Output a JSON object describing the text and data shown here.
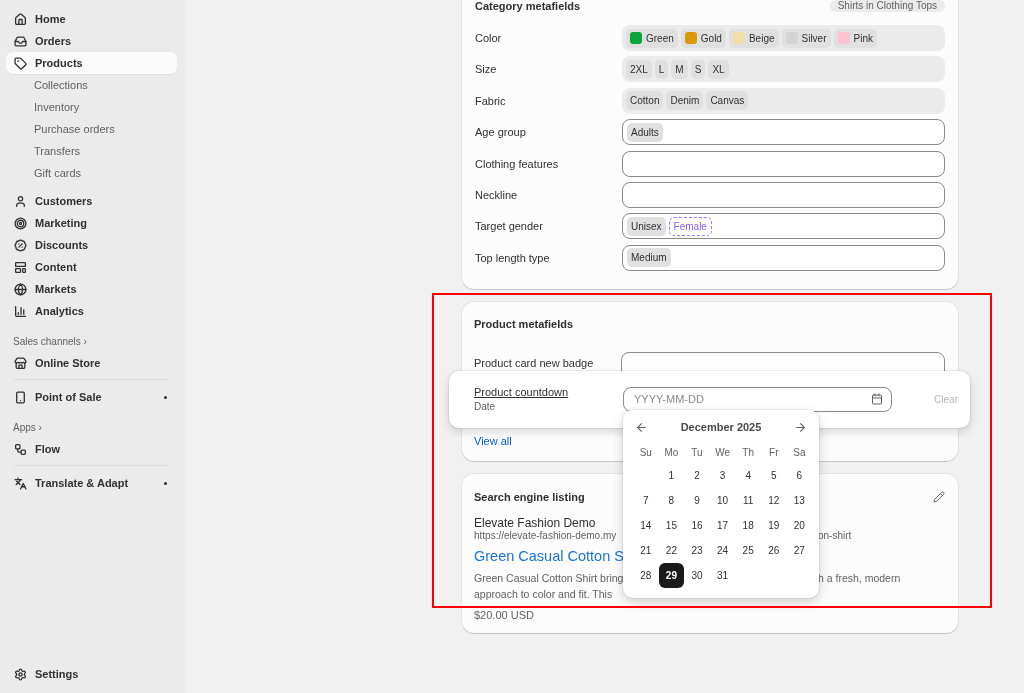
{
  "sidebar": {
    "items": [
      {
        "kind": "main",
        "label": "Home",
        "selected": false
      },
      {
        "kind": "main",
        "label": "Orders",
        "selected": false
      },
      {
        "kind": "main",
        "label": "Products",
        "selected": true
      },
      {
        "kind": "sub",
        "label": "Collections",
        "selected": false
      },
      {
        "kind": "sub",
        "label": "Inventory",
        "selected": false
      },
      {
        "kind": "sub",
        "label": "Purchase orders",
        "selected": false
      },
      {
        "kind": "sub",
        "label": "Transfers",
        "selected": false
      },
      {
        "kind": "sub",
        "label": "Gift cards",
        "selected": false
      },
      {
        "kind": "main",
        "label": "Customers",
        "selected": false,
        "gap_before": true
      },
      {
        "kind": "main",
        "label": "Marketing",
        "selected": false
      },
      {
        "kind": "main",
        "label": "Discounts",
        "selected": false
      },
      {
        "kind": "main",
        "label": "Content",
        "selected": false
      },
      {
        "kind": "main",
        "label": "Markets",
        "selected": false
      },
      {
        "kind": "main",
        "label": "Analytics",
        "selected": false
      },
      {
        "kind": "section",
        "label": "Sales channels",
        "chevron": "›"
      },
      {
        "kind": "main",
        "label": "Online Store",
        "selected": false
      },
      {
        "kind": "main",
        "label": "Point of Sale",
        "selected": false,
        "divider_before": true,
        "dot": true
      },
      {
        "kind": "section",
        "label": "Apps",
        "chevron": "›"
      },
      {
        "kind": "main",
        "label": "Flow",
        "selected": false
      },
      {
        "kind": "main",
        "label": "Translate & Adapt",
        "selected": false,
        "divider_before": true,
        "dot": true
      }
    ],
    "settings": "Settings"
  },
  "category_card": {
    "title": "Category metafields",
    "badge": "Shirts in Clothing Tops",
    "fields": [
      {
        "label": "Color",
        "kind": "swatches",
        "values": [
          {
            "label": "Green",
            "color": "#0ca53c"
          },
          {
            "label": "Gold",
            "color": "#d9990b"
          },
          {
            "label": "Beige",
            "color": "#f0dfa8"
          },
          {
            "label": "Silver",
            "color": "#d4d4d4"
          },
          {
            "label": "Pink",
            "color": "#fbc3cf"
          }
        ]
      },
      {
        "label": "Size",
        "kind": "readonly",
        "values": [
          {
            "label": "2XL"
          },
          {
            "label": "L"
          },
          {
            "label": "M"
          },
          {
            "label": "S"
          },
          {
            "label": "XL"
          }
        ]
      },
      {
        "label": "Fabric",
        "kind": "readonly",
        "values": [
          {
            "label": "Cotton"
          },
          {
            "label": "Denim"
          },
          {
            "label": "Canvas"
          }
        ]
      },
      {
        "label": "Age group",
        "kind": "input",
        "values": [
          {
            "label": "Adults",
            "suggested": false
          }
        ]
      },
      {
        "label": "Clothing features",
        "kind": "input"
      },
      {
        "label": "Neckline",
        "kind": "input"
      },
      {
        "label": "Target gender",
        "kind": "input",
        "values": [
          {
            "label": "Unisex",
            "suggested": false
          },
          {
            "label": "Female",
            "suggested": true
          }
        ]
      },
      {
        "label": "Top length type",
        "kind": "input",
        "values": [
          {
            "label": "Medium",
            "suggested": false
          }
        ]
      }
    ]
  },
  "product_card": {
    "title": "Product metafields",
    "fields": [
      {
        "label": "Product card new badge"
      }
    ],
    "active_field": {
      "label": "Product countdown",
      "type": "Date",
      "placeholder": "YYYY-MM-DD",
      "clear": "Clear"
    },
    "link": "View all"
  },
  "calendar": {
    "month": "December 2025",
    "weekdays": [
      "Su",
      "Mo",
      "Tu",
      "We",
      "Th",
      "Fr",
      "Sa"
    ],
    "weeks": [
      {
        "days": [
          {
            "label": "1",
            "selected": false
          },
          {
            "label": "2",
            "selected": false
          },
          {
            "label": "3",
            "selected": false
          },
          {
            "label": "4",
            "selected": false
          },
          {
            "label": "5",
            "selected": false
          },
          {
            "label": "6",
            "selected": false
          }
        ]
      },
      {
        "days": [
          {
            "label": "7",
            "selected": false
          },
          {
            "label": "8",
            "selected": false
          },
          {
            "label": "9",
            "selected": false
          },
          {
            "label": "10",
            "selected": false
          },
          {
            "label": "11",
            "selected": false
          },
          {
            "label": "12",
            "selected": false
          },
          {
            "label": "13",
            "selected": false
          }
        ]
      },
      {
        "days": [
          {
            "label": "14",
            "selected": false
          },
          {
            "label": "15",
            "selected": false
          },
          {
            "label": "16",
            "selected": false
          },
          {
            "label": "17",
            "selected": false
          },
          {
            "label": "18",
            "selected": false
          },
          {
            "label": "19",
            "selected": false
          },
          {
            "label": "20",
            "selected": false
          }
        ]
      },
      {
        "days": [
          {
            "label": "21",
            "selected": false
          },
          {
            "label": "22",
            "selected": false
          },
          {
            "label": "23",
            "selected": false
          },
          {
            "label": "24",
            "selected": false
          },
          {
            "label": "25",
            "selected": false
          },
          {
            "label": "26",
            "selected": false
          },
          {
            "label": "27",
            "selected": false
          }
        ]
      },
      {
        "days": [
          {
            "label": "28",
            "selected": false
          },
          {
            "label": "29",
            "selected": true
          },
          {
            "label": "30",
            "selected": false
          },
          {
            "label": "31",
            "selected": false
          }
        ]
      }
    ]
  },
  "seo_card": {
    "title": "Search engine listing",
    "store": "Elevate Fashion Demo",
    "url_left": "https://elevate-fashion-demo.my",
    "url_right": "on-shirt",
    "page_title": "Green Casual Cotton S",
    "desc_left": "Green Casual Cotton Shirt bring",
    "desc_right": "h a fresh, modern",
    "desc_line2": "approach to color and fit. This",
    "price": "$20.00 USD"
  }
}
